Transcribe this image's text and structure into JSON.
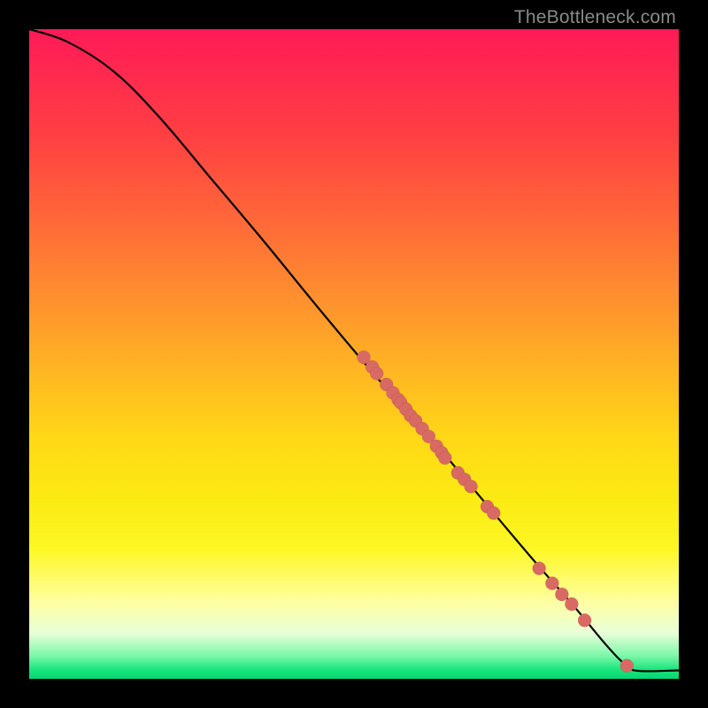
{
  "watermark": "TheBottleneck.com",
  "chart_data": {
    "type": "line",
    "title": "",
    "xlabel": "",
    "ylabel": "",
    "xlim": [
      0,
      100
    ],
    "ylim": [
      0,
      100
    ],
    "grid": false,
    "curve": [
      {
        "x": 0,
        "y": 100
      },
      {
        "x": 6,
        "y": 98
      },
      {
        "x": 13,
        "y": 93.5
      },
      {
        "x": 20,
        "y": 86.5
      },
      {
        "x": 28,
        "y": 77
      },
      {
        "x": 36,
        "y": 67.5
      },
      {
        "x": 45,
        "y": 56.5
      },
      {
        "x": 53,
        "y": 47
      },
      {
        "x": 61,
        "y": 38
      },
      {
        "x": 69,
        "y": 28.5
      },
      {
        "x": 77,
        "y": 19
      },
      {
        "x": 84,
        "y": 11
      },
      {
        "x": 89,
        "y": 5
      },
      {
        "x": 92,
        "y": 2
      },
      {
        "x": 94,
        "y": 1.2
      },
      {
        "x": 100,
        "y": 1.3
      }
    ],
    "markers": [
      {
        "x": 51.5,
        "y": 49.5
      },
      {
        "x": 52.8,
        "y": 48.0
      },
      {
        "x": 53.5,
        "y": 47.0
      },
      {
        "x": 55.0,
        "y": 45.3
      },
      {
        "x": 56.0,
        "y": 44.0
      },
      {
        "x": 56.8,
        "y": 43.0
      },
      {
        "x": 57.2,
        "y": 42.5
      },
      {
        "x": 58.0,
        "y": 41.5
      },
      {
        "x": 58.7,
        "y": 40.5
      },
      {
        "x": 59.5,
        "y": 39.7
      },
      {
        "x": 60.5,
        "y": 38.5
      },
      {
        "x": 61.5,
        "y": 37.3
      },
      {
        "x": 62.7,
        "y": 35.8
      },
      {
        "x": 63.5,
        "y": 34.8
      },
      {
        "x": 64.0,
        "y": 34.0
      },
      {
        "x": 66.0,
        "y": 31.7
      },
      {
        "x": 67.0,
        "y": 30.7
      },
      {
        "x": 68.0,
        "y": 29.6
      },
      {
        "x": 70.5,
        "y": 26.5
      },
      {
        "x": 71.5,
        "y": 25.5
      },
      {
        "x": 78.5,
        "y": 17.0
      },
      {
        "x": 80.5,
        "y": 14.7
      },
      {
        "x": 82.0,
        "y": 13.0
      },
      {
        "x": 83.5,
        "y": 11.5
      },
      {
        "x": 85.5,
        "y": 9.0
      },
      {
        "x": 92.0,
        "y": 2.0
      }
    ],
    "colors": {
      "curve": "#000000",
      "marker": "#d96a63",
      "gradient_top": "#ff1a57",
      "gradient_bottom": "#00d873",
      "frame": "#000000"
    }
  }
}
